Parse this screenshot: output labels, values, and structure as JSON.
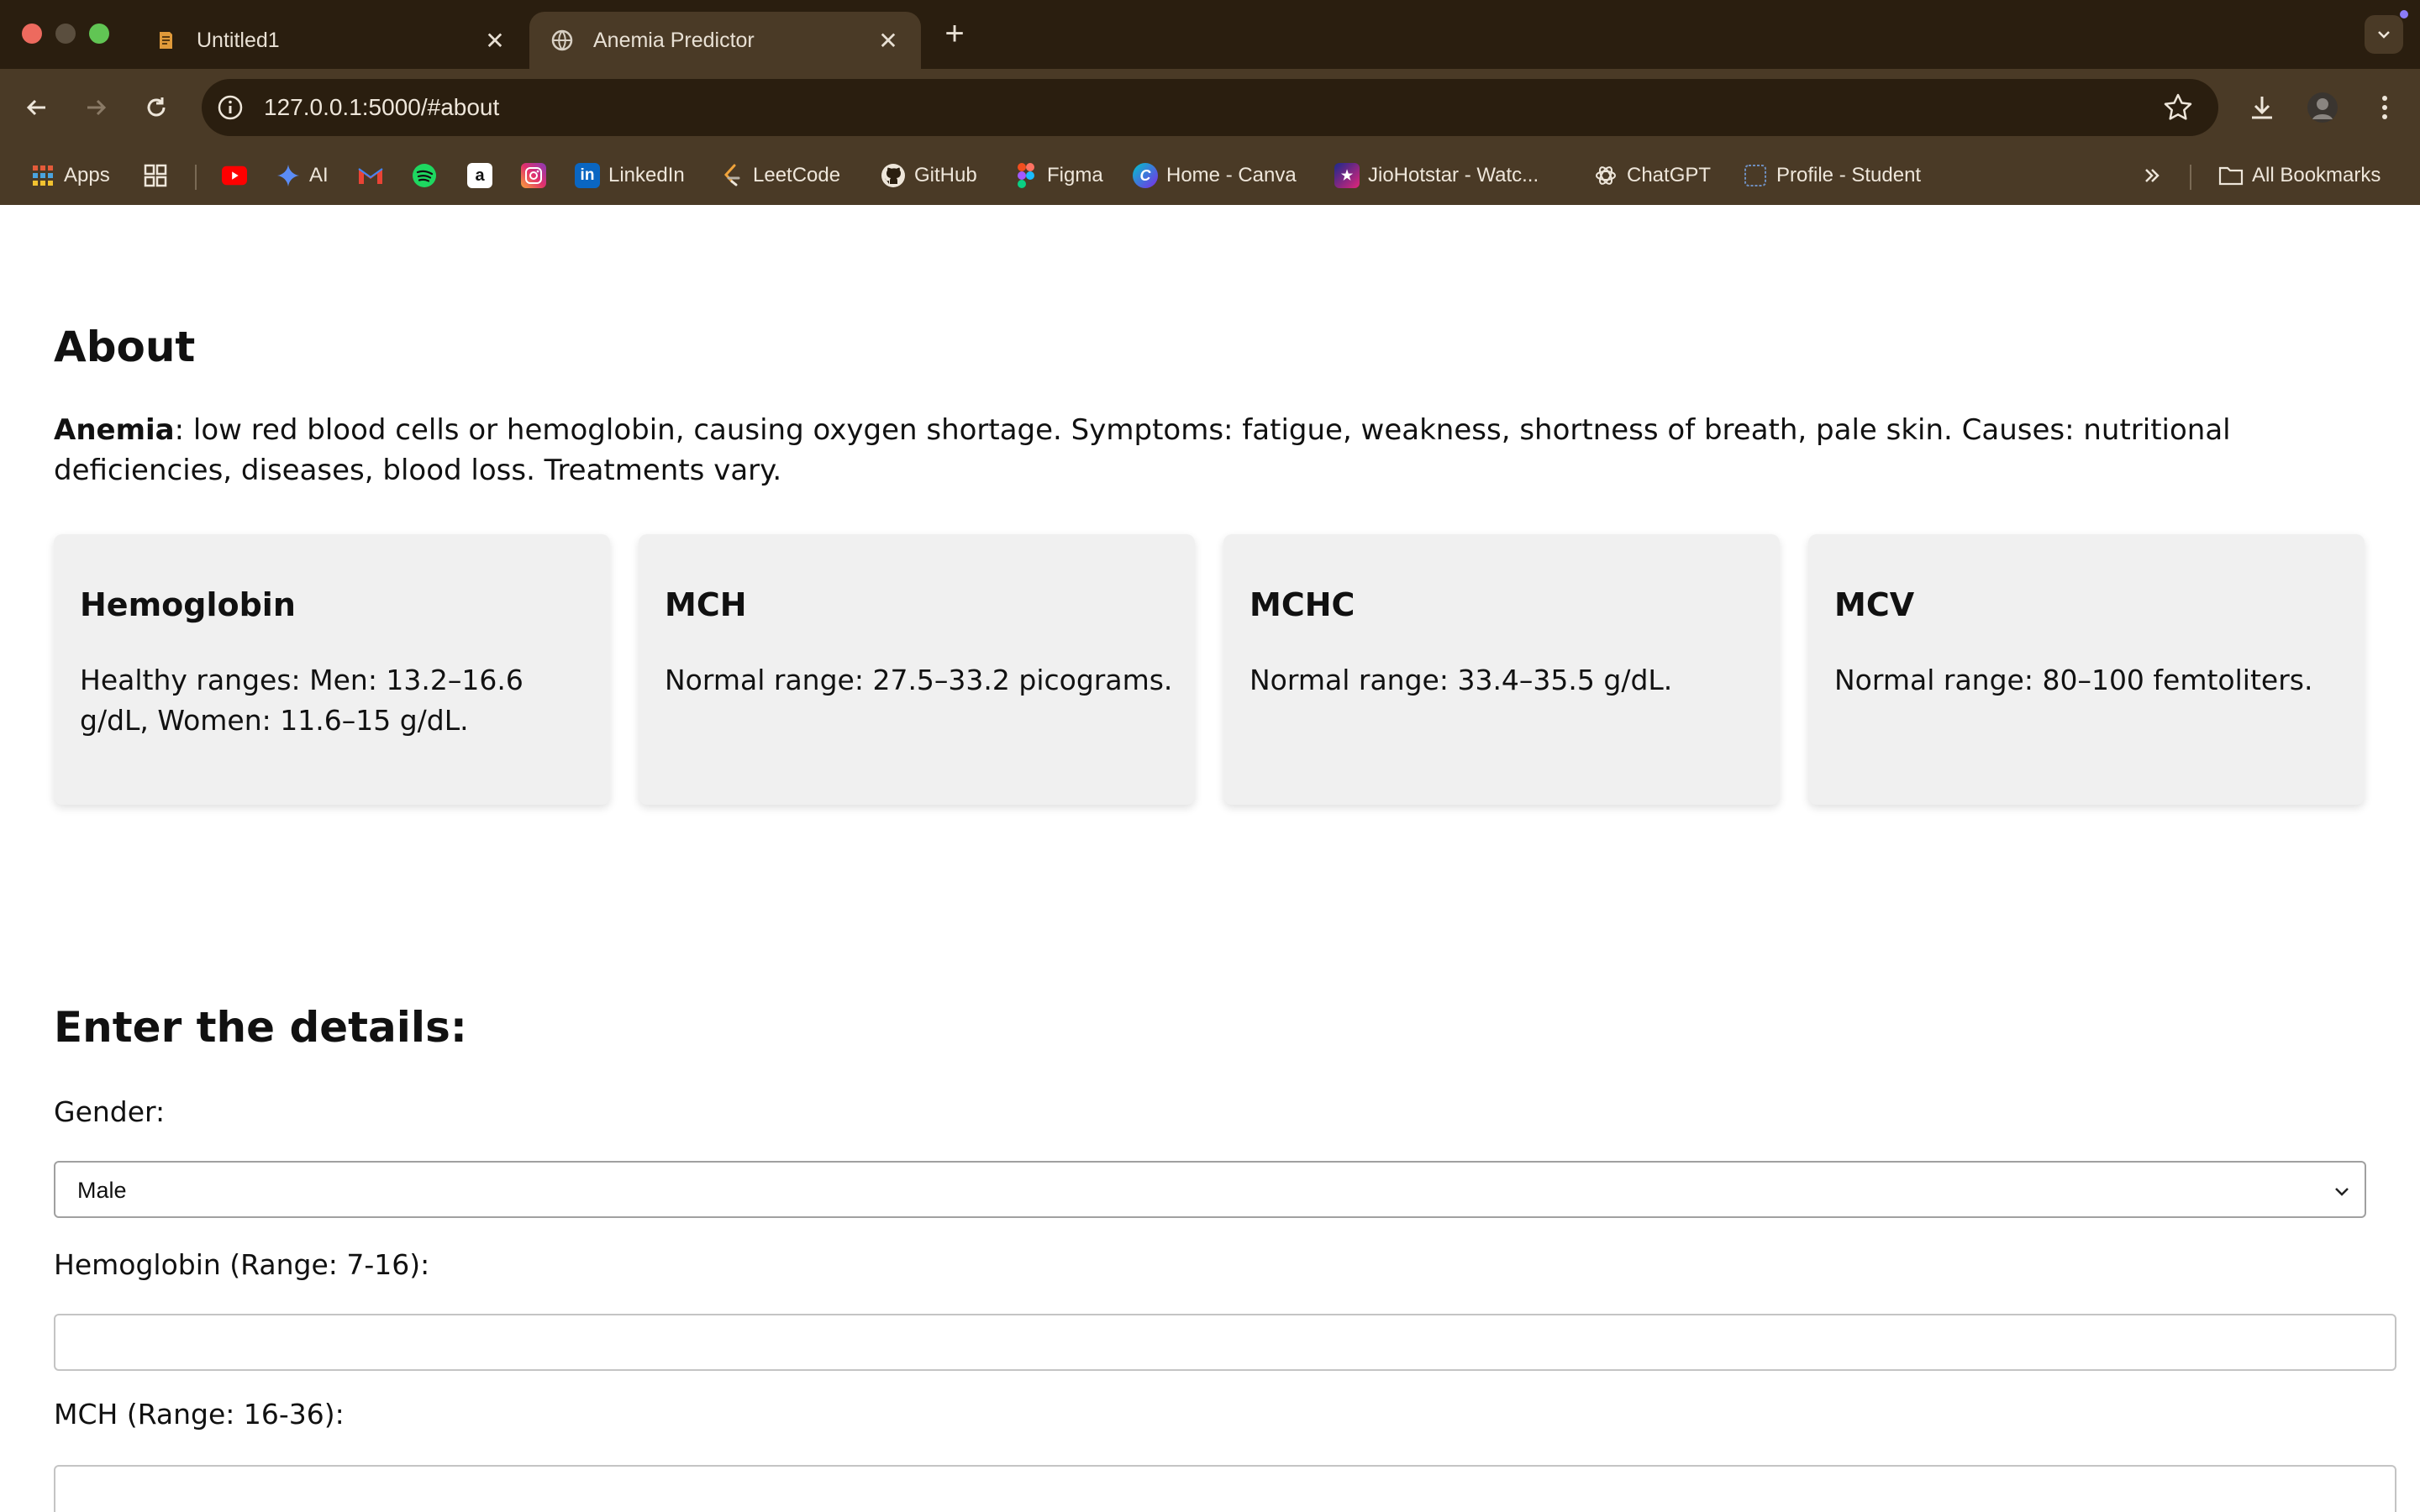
{
  "browser": {
    "tabs": [
      {
        "title": "Untitled1",
        "icon": "document-icon"
      },
      {
        "title": "Anemia Predictor",
        "icon": "globe-icon"
      }
    ],
    "url": "127.0.0.1:5000/#about",
    "bookmarks": [
      {
        "label": "Apps",
        "icon": "apps-grid-icon"
      },
      {
        "label": "",
        "icon": "tab-groups-icon"
      },
      {
        "label": "",
        "icon": "youtube-icon"
      },
      {
        "label": "AI",
        "icon": "sparkle-icon"
      },
      {
        "label": "",
        "icon": "gmail-icon"
      },
      {
        "label": "",
        "icon": "spotify-icon"
      },
      {
        "label": "",
        "icon": "amazon-icon"
      },
      {
        "label": "",
        "icon": "instagram-icon"
      },
      {
        "label": "LinkedIn",
        "icon": "linkedin-icon"
      },
      {
        "label": "LeetCode",
        "icon": "leetcode-icon"
      },
      {
        "label": "GitHub",
        "icon": "github-icon"
      },
      {
        "label": "Figma",
        "icon": "figma-icon"
      },
      {
        "label": "Home - Canva",
        "icon": "canva-icon"
      },
      {
        "label": "JioHotstar - Watc...",
        "icon": "hotstar-icon"
      },
      {
        "label": "ChatGPT",
        "icon": "chatgpt-icon"
      },
      {
        "label": "Profile - Student",
        "icon": "profile-icon"
      }
    ],
    "all_bookmarks": "All Bookmarks"
  },
  "about": {
    "title": "About",
    "lead_bold": "Anemia",
    "text": ": low red blood cells or hemoglobin, causing oxygen shortage. Symptoms: fatigue, weakness, shortness of breath, pale skin. Causes: nutritional deficiencies, diseases, blood loss. Treatments vary."
  },
  "cards": [
    {
      "title": "Hemoglobin",
      "text": "Healthy ranges: Men: 13.2–16.6 g/dL, Women: 11.6–15 g/dL."
    },
    {
      "title": "MCH",
      "text": "Normal range: 27.5–33.2 picograms."
    },
    {
      "title": "MCHC",
      "text": "Normal range: 33.4–35.5 g/dL."
    },
    {
      "title": "MCV",
      "text": "Normal range: 80–100 femtoliters."
    }
  ],
  "form": {
    "title": "Enter the details:",
    "gender_label": "Gender:",
    "gender_value": "Male",
    "hemoglobin_label": "Hemoglobin (Range: 7-16):",
    "hemoglobin_value": "",
    "mch_label": "MCH (Range: 16-36):",
    "mch_value": ""
  }
}
